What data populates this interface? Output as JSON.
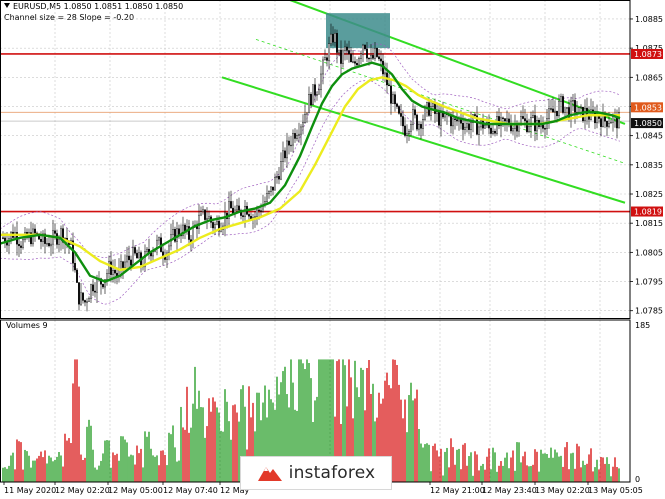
{
  "chart_data": {
    "type": "candlestick",
    "header": {
      "symbol_line": "EURUSD,M5  1.0850 1.0851 1.0850 1.0850",
      "channel_line": "Channel size = 28 Slope = -0.20"
    },
    "price_axis": {
      "ylim": [
        1.07825,
        1.08915
      ],
      "ticks": [
        "1.0885",
        "1.0875",
        "1.0865",
        "1.0855",
        "1.0845",
        "1.0835",
        "1.0825",
        "1.0815",
        "1.0805",
        "1.0795",
        "1.0785"
      ],
      "tick_values": [
        1.0885,
        1.0875,
        1.0865,
        1.0855,
        1.0845,
        1.0835,
        1.0825,
        1.0815,
        1.0805,
        1.0795,
        1.0785
      ]
    },
    "levels": [
      {
        "label": "1.0873",
        "value": 1.0873,
        "color": "#d01010"
      },
      {
        "label": "1.0819",
        "value": 1.0819,
        "color": "#d01010"
      }
    ],
    "price_labels": [
      {
        "label": "1.0853",
        "value": 1.0853,
        "color": "#e05a1c"
      },
      {
        "label": "1.0850",
        "value": 1.085,
        "color": "#111111"
      }
    ],
    "x_ticks": [
      "11 May 2020",
      "12 May 02:20",
      "12 May 05:00",
      "12 May 07:40",
      "12 May",
      "12 May 21:00",
      "12 May 23:40",
      "13 May 02:20",
      "13 May 05:05"
    ],
    "volume_label": "Volumes 9",
    "volume_axis": {
      "ylim": [
        0,
        185
      ],
      "ticks": [
        "185",
        "0"
      ]
    },
    "close_path": [
      [
        0,
        1.081
      ],
      [
        8,
        1.081
      ],
      [
        14,
        1.0812
      ],
      [
        22,
        1.0808
      ],
      [
        28,
        1.081
      ],
      [
        35,
        1.0811
      ],
      [
        45,
        1.0808
      ],
      [
        55,
        1.081
      ],
      [
        62,
        1.0812
      ],
      [
        72,
        1.0806
      ],
      [
        78,
        1.079
      ],
      [
        85,
        1.0788
      ],
      [
        92,
        1.0794
      ],
      [
        102,
        1.0795
      ],
      [
        110,
        1.08
      ],
      [
        118,
        1.0797
      ],
      [
        126,
        1.0802
      ],
      [
        134,
        1.0804
      ],
      [
        142,
        1.0801
      ],
      [
        150,
        1.0806
      ],
      [
        158,
        1.0808
      ],
      [
        166,
        1.0805
      ],
      [
        174,
        1.0811
      ],
      [
        182,
        1.0813
      ],
      [
        190,
        1.081
      ],
      [
        198,
        1.0816
      ],
      [
        206,
        1.0818
      ],
      [
        214,
        1.0814
      ],
      [
        222,
        1.0816
      ],
      [
        230,
        1.082
      ],
      [
        238,
        1.0818
      ],
      [
        246,
        1.0821
      ],
      [
        254,
        1.0817
      ],
      [
        262,
        1.0821
      ],
      [
        270,
        1.0825
      ],
      [
        278,
        1.0832
      ],
      [
        286,
        1.084
      ],
      [
        294,
        1.0846
      ],
      [
        302,
        1.085
      ],
      [
        310,
        1.0858
      ],
      [
        318,
        1.0862
      ],
      [
        326,
        1.0872
      ],
      [
        334,
        1.088
      ],
      [
        340,
        1.087
      ],
      [
        346,
        1.0875
      ],
      [
        352,
        1.0868
      ],
      [
        358,
        1.0872
      ],
      [
        364,
        1.0878
      ],
      [
        370,
        1.087
      ],
      [
        376,
        1.0873
      ],
      [
        382,
        1.0868
      ],
      [
        388,
        1.0862
      ],
      [
        394,
        1.0855
      ],
      [
        400,
        1.085
      ],
      [
        406,
        1.0847
      ],
      [
        412,
        1.0852
      ],
      [
        418,
        1.0849
      ],
      [
        424,
        1.0852
      ],
      [
        430,
        1.0855
      ],
      [
        436,
        1.0852
      ],
      [
        442,
        1.085
      ],
      [
        448,
        1.0852
      ],
      [
        454,
        1.0849
      ],
      [
        460,
        1.0851
      ],
      [
        466,
        1.0848
      ],
      [
        472,
        1.085
      ],
      [
        478,
        1.0848
      ],
      [
        484,
        1.0849
      ],
      [
        490,
        1.0847
      ],
      [
        496,
        1.0849
      ],
      [
        502,
        1.0848
      ],
      [
        508,
        1.085
      ],
      [
        514,
        1.0848
      ],
      [
        520,
        1.0851
      ],
      [
        526,
        1.0849
      ],
      [
        532,
        1.085
      ],
      [
        538,
        1.0848
      ],
      [
        544,
        1.085
      ],
      [
        550,
        1.0852
      ],
      [
        556,
        1.0854
      ],
      [
        562,
        1.0856
      ],
      [
        568,
        1.0853
      ],
      [
        574,
        1.0855
      ],
      [
        580,
        1.0852
      ],
      [
        586,
        1.0853
      ],
      [
        592,
        1.0851
      ],
      [
        598,
        1.0852
      ],
      [
        604,
        1.085
      ],
      [
        610,
        1.0851
      ],
      [
        616,
        1.085
      ]
    ],
    "ma_fast": [
      [
        0,
        1.0808
      ],
      [
        20,
        1.081
      ],
      [
        40,
        1.0811
      ],
      [
        60,
        1.081
      ],
      [
        75,
        1.0805
      ],
      [
        90,
        1.0797
      ],
      [
        105,
        1.0795
      ],
      [
        120,
        1.0797
      ],
      [
        135,
        1.0801
      ],
      [
        150,
        1.0805
      ],
      [
        165,
        1.0808
      ],
      [
        180,
        1.0811
      ],
      [
        195,
        1.0814
      ],
      [
        210,
        1.0816
      ],
      [
        225,
        1.0817
      ],
      [
        240,
        1.0819
      ],
      [
        255,
        1.082
      ],
      [
        270,
        1.0822
      ],
      [
        285,
        1.0828
      ],
      [
        300,
        1.0838
      ],
      [
        312,
        1.0848
      ],
      [
        322,
        1.0856
      ],
      [
        332,
        1.0862
      ],
      [
        342,
        1.0866
      ],
      [
        352,
        1.0868
      ],
      [
        362,
        1.0869
      ],
      [
        372,
        1.087
      ],
      [
        382,
        1.0869
      ],
      [
        392,
        1.0866
      ],
      [
        402,
        1.0861
      ],
      [
        412,
        1.0857
      ],
      [
        422,
        1.0855
      ],
      [
        432,
        1.0854
      ],
      [
        444,
        1.0853
      ],
      [
        458,
        1.0851
      ],
      [
        472,
        1.085
      ],
      [
        486,
        1.0849
      ],
      [
        500,
        1.0849
      ],
      [
        514,
        1.0849
      ],
      [
        528,
        1.0849
      ],
      [
        542,
        1.0849
      ],
      [
        556,
        1.085
      ],
      [
        570,
        1.0852
      ],
      [
        584,
        1.0853
      ],
      [
        598,
        1.0853
      ],
      [
        612,
        1.0852
      ],
      [
        620,
        1.0851
      ]
    ],
    "ma_slow": [
      [
        0,
        1.0811
      ],
      [
        20,
        1.0811
      ],
      [
        40,
        1.0811
      ],
      [
        60,
        1.081
      ],
      [
        80,
        1.0807
      ],
      [
        100,
        1.0802
      ],
      [
        120,
        1.0799
      ],
      [
        140,
        1.08
      ],
      [
        160,
        1.0803
      ],
      [
        180,
        1.0806
      ],
      [
        200,
        1.081
      ],
      [
        220,
        1.0813
      ],
      [
        240,
        1.0815
      ],
      [
        260,
        1.0817
      ],
      [
        280,
        1.082
      ],
      [
        300,
        1.0826
      ],
      [
        315,
        1.0835
      ],
      [
        330,
        1.0845
      ],
      [
        345,
        1.0855
      ],
      [
        358,
        1.0861
      ],
      [
        370,
        1.0864
      ],
      [
        382,
        1.0865
      ],
      [
        394,
        1.0864
      ],
      [
        406,
        1.0862
      ],
      [
        418,
        1.0859
      ],
      [
        430,
        1.0857
      ],
      [
        444,
        1.0855
      ],
      [
        460,
        1.0853
      ],
      [
        476,
        1.0851
      ],
      [
        492,
        1.085
      ],
      [
        508,
        1.0849
      ],
      [
        524,
        1.0849
      ],
      [
        540,
        1.0849
      ],
      [
        556,
        1.085
      ],
      [
        572,
        1.0851
      ],
      [
        588,
        1.0852
      ],
      [
        604,
        1.0852
      ],
      [
        620,
        1.0852
      ]
    ],
    "channel": {
      "upper": [
        [
          290,
          1.08915
        ],
        [
          625,
          1.0849
        ]
      ],
      "lower": [
        [
          222,
          1.0865
        ],
        [
          625,
          1.0822
        ]
      ],
      "middle": [
        [
          256,
          1.0878
        ],
        [
          625,
          1.08355
        ]
      ]
    },
    "highlight_box": {
      "x0": 326,
      "x1": 390,
      "y0": 1.0887,
      "y1": 1.0875,
      "color": "#3d8c8c"
    },
    "colors": {
      "bull_volume": "#2ba02b",
      "bear_volume": "#d81818",
      "ma_fast": "#0e8f0e",
      "ma_slow": "#ecec1e",
      "channel": "#33dd22",
      "envelope": "#a060c0",
      "candle": "#000000",
      "grid": "#c8c8c8",
      "level": "#d01010"
    }
  },
  "watermark": {
    "brand": "instaforex",
    "icon": "mountain-logo-icon"
  }
}
